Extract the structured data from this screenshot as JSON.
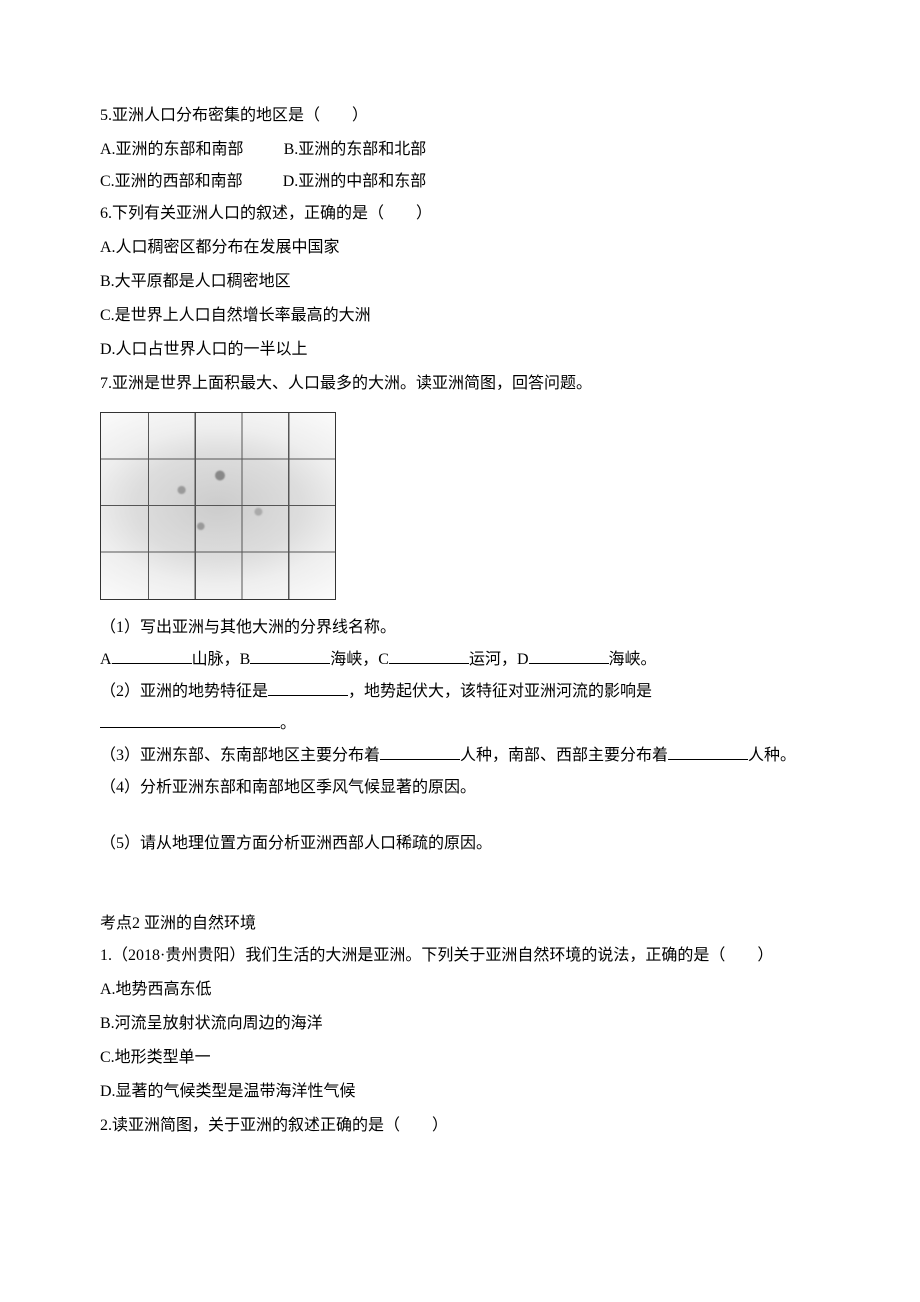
{
  "q5": {
    "stem": "5.亚洲人口分布密集的地区是（　　）",
    "optA": "A.亚洲的东部和南部",
    "optB": "B.亚洲的东部和北部",
    "optC": "C.亚洲的西部和南部",
    "optD": "D.亚洲的中部和东部"
  },
  "q6": {
    "stem": "6.下列有关亚洲人口的叙述，正确的是（　　）",
    "optA": "A.人口稠密区都分布在发展中国家",
    "optB": "B.大平原都是人口稠密地区",
    "optC": "C.是世界上人口自然增长率最高的大洲",
    "optD": "D.人口占世界人口的一半以上"
  },
  "q7": {
    "stem": "7.亚洲是世界上面积最大、人口最多的大洲。读亚洲简图，回答问题。",
    "sub1_intro": "（1）写出亚洲与其他大洲的分界线名称。",
    "sub1_A_pre": "A",
    "sub1_A_post": "山脉，B",
    "sub1_B_post": "海峡，C",
    "sub1_C_post": "运河，D",
    "sub1_D_post": "海峡。",
    "sub2_pre": "（2）亚洲的地势特征是",
    "sub2_mid": "，地势起伏大，该特征对亚洲河流的影响是",
    "sub2_post": "。",
    "sub3_pre": "（3）亚洲东部、东南部地区主要分布着",
    "sub3_mid": "人种，南部、西部主要分布着",
    "sub3_post": "人种。",
    "sub4": "（4）分析亚洲东部和南部地区季风气候显著的原因。",
    "sub5": "（5）请从地理位置方面分析亚洲西部人口稀疏的原因。"
  },
  "section2_title": "考点2 亚洲的自然环境",
  "s2q1": {
    "stem": "1.（2018·贵州贵阳）我们生活的大洲是亚洲。下列关于亚洲自然环境的说法，正确的是（　　）",
    "optA": "A.地势西高东低",
    "optB": "B.河流呈放射状流向周边的海洋",
    "optC": "C.地形类型单一",
    "optD": "D.显著的气候类型是温带海洋性气候"
  },
  "s2q2": {
    "stem": "2.读亚洲简图，关于亚洲的叙述正确的是（　　）"
  }
}
